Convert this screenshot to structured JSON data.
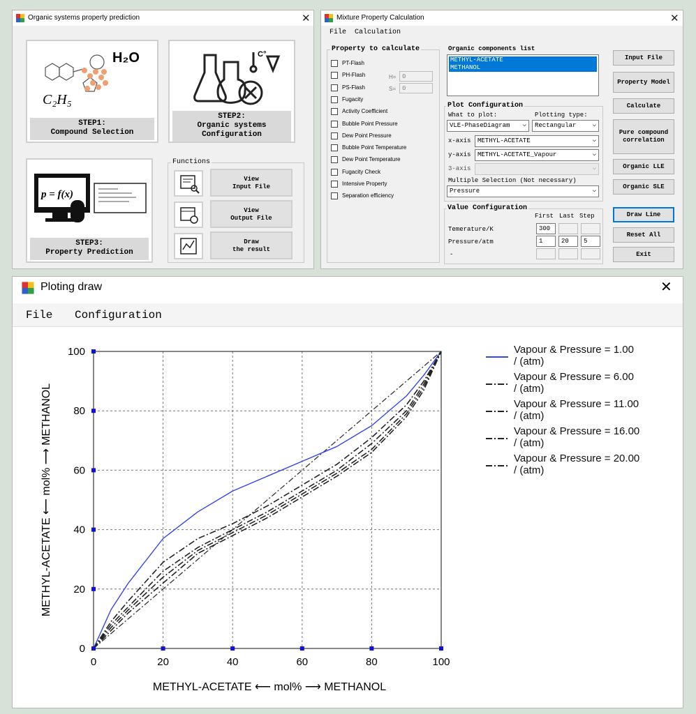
{
  "win1": {
    "title": "Organic systems property prediction",
    "step1": {
      "line1": "STEP1:",
      "line2": "Compound Selection",
      "formula": "H₂O",
      "formula2": "C₂H₅"
    },
    "step2": {
      "line1": "STEP2:",
      "line2": "Organic systems",
      "line3": "Configuration"
    },
    "step3": {
      "line1": "STEP3:",
      "line2": "Property Prediction",
      "equation": "p = f(x)"
    },
    "functions_label": "Functions",
    "buttons": [
      {
        "line1": "View",
        "line2": "Input File"
      },
      {
        "line1": "View",
        "line2": "Output File"
      },
      {
        "line1": "Draw",
        "line2": "the result"
      }
    ]
  },
  "win2": {
    "title": "Mixture Property Calculation",
    "menu": [
      "File",
      "Calculation"
    ],
    "property_group_label": "Property to calculate",
    "properties": [
      "PT-Flash",
      "PH-Flash",
      "PS-Flash",
      "Fugacity",
      "Activity Coefficient",
      "Bubble Point Pressure",
      "Dew Point Pressure",
      "Bubble Point Temperature",
      "Dew Point Temperature",
      "Fugacity Check",
      "Intensive Property",
      "Separation efficiency"
    ],
    "h_label": "H=",
    "h_value": "0",
    "s_label": "S=",
    "s_value": "0",
    "components_label": "Organic components list",
    "components": [
      "METHYL-ACETATE",
      "METHANOL"
    ],
    "plot_config_label": "Plot Configuration",
    "what_to_plot_label": "What to plot:",
    "what_to_plot": "VLE-PhaseDiagram",
    "plotting_type_label": "Plotting type:",
    "plotting_type": "Rectangular",
    "x_axis_label": "x-axis",
    "x_axis": "METHYL-ACETATE",
    "y_axis_label": "y-axis",
    "y_axis": "METHYL-ACETATE_Vapour",
    "z_axis_label": "3-axis",
    "z_axis": "",
    "multiple_label": "Multiple Selection (Not necessary)",
    "multiple": "Pressure",
    "value_config_label": "Value Configuration",
    "col_first": "First",
    "col_last": "Last",
    "col_step": "Step",
    "rows": [
      {
        "label": "Temerature/K",
        "first": "300",
        "last": "",
        "step": ""
      },
      {
        "label": "Pressure/atm",
        "first": "1",
        "last": "20",
        "step": "5"
      },
      {
        "label": "-",
        "first": "",
        "last": "",
        "step": ""
      }
    ],
    "side_buttons": [
      "Input File",
      "Property Model",
      "Calculate",
      "Pure compound correlation",
      "Organic LLE",
      "Organic SLE",
      "Draw Line",
      "Reset All",
      "Exit"
    ]
  },
  "win3": {
    "title": "Ploting draw",
    "menu": [
      "File",
      "Configuration"
    ]
  },
  "chart_data": {
    "type": "line",
    "xlabel": "METHYL-ACETATE ⟵ mol% ⟶ METHANOL",
    "ylabel": "METHYL-ACETATE ⟵ mol% ⟶ METHANOL",
    "xlim": [
      0,
      100
    ],
    "ylim": [
      0,
      100
    ],
    "xticks": [
      0,
      20,
      40,
      60,
      80,
      100
    ],
    "yticks": [
      0,
      20,
      40,
      60,
      80,
      100
    ],
    "grid": true,
    "legend_position": "right",
    "x": [
      0,
      5,
      10,
      20,
      30,
      40,
      50,
      60,
      70,
      80,
      90,
      95,
      100
    ],
    "series": [
      {
        "name": "Vapour & Pressure = 1.00 / (atm)",
        "style": "solid",
        "color": "#3344ee",
        "values": [
          0,
          13,
          22,
          37,
          46,
          53,
          58,
          63,
          68,
          75,
          85,
          92,
          100
        ]
      },
      {
        "name": "Vapour & Pressure = 6.00 / (atm)",
        "style": "dashdot",
        "color": "#222222",
        "values": [
          0,
          9,
          16,
          29,
          37,
          42,
          48,
          55,
          62,
          71,
          82,
          90,
          100
        ]
      },
      {
        "name": "Vapour & Pressure = 11.00 / (atm)",
        "style": "dashdot",
        "color": "#222222",
        "values": [
          0,
          8,
          14,
          26,
          34,
          40,
          46,
          53,
          60,
          69,
          80,
          89,
          100
        ]
      },
      {
        "name": "Vapour & Pressure = 16.00 / (atm)",
        "style": "dashdot",
        "color": "#222222",
        "values": [
          0,
          7,
          13,
          24,
          33,
          39,
          45,
          52,
          59,
          67,
          79,
          88,
          100
        ]
      },
      {
        "name": "Vapour & Pressure = 20.00 / (atm)",
        "style": "dashdot",
        "color": "#222222",
        "values": [
          0,
          6,
          12,
          22,
          32,
          38,
          44,
          51,
          58,
          66,
          78,
          87,
          100
        ]
      }
    ]
  }
}
